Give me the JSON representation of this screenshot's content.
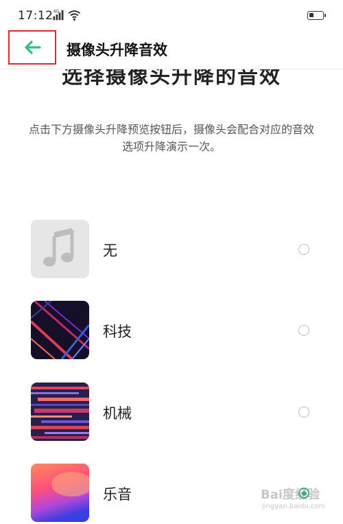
{
  "status_bar": {
    "time": "17:12",
    "network": "4G",
    "icons": [
      "signal-icon",
      "wifi-icon",
      "battery-icon"
    ]
  },
  "header": {
    "back_icon": "arrow-left-icon",
    "title": "摄像头升降音效"
  },
  "section": {
    "title": "选择摄像头升降的音效",
    "description": "点击下方摄像头升降预览按钮后，摄像头会配合对应的音效选项升降演示一次。"
  },
  "options": [
    {
      "label": "无",
      "thumb": "music-note-icon",
      "selected": false
    },
    {
      "label": "科技",
      "thumb": "tech-artwork",
      "selected": false
    },
    {
      "label": "机械",
      "thumb": "mechanical-artwork",
      "selected": false
    },
    {
      "label": "乐音",
      "thumb": "musical-artwork",
      "selected": true
    }
  ],
  "colors": {
    "accent": "#1fb07a",
    "highlight_box": "#e0262f"
  },
  "watermark": {
    "main": "Bai度经验",
    "sub": "jingyan.baidu.com"
  }
}
